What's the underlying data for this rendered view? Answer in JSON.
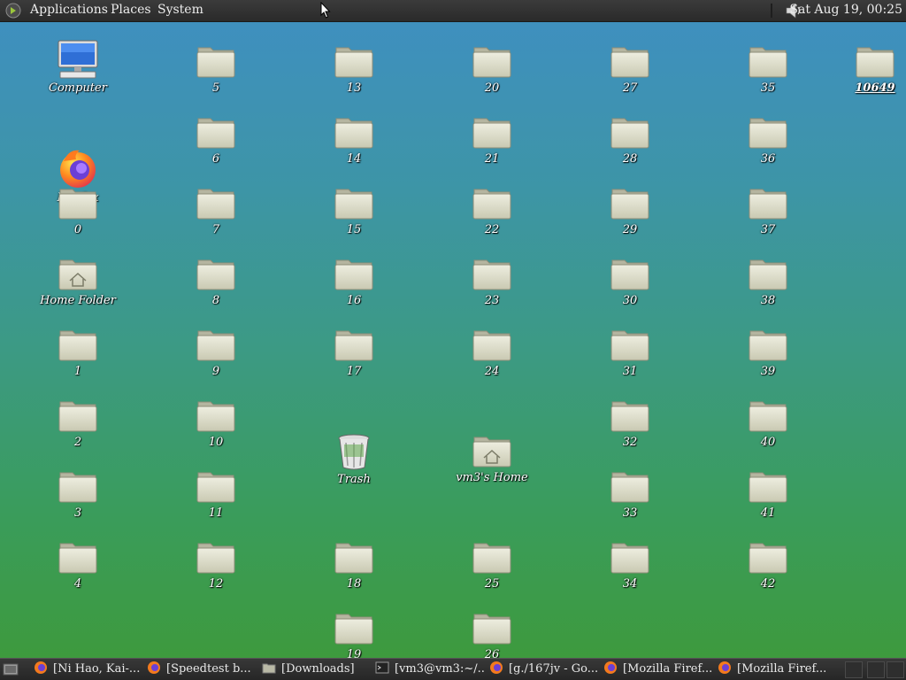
{
  "top_panel": {
    "menus": [
      "Applications",
      "Places",
      "System"
    ],
    "clock": "Sat Aug 19, 00:25"
  },
  "desktop": {
    "computer": "Computer",
    "firefox": "Firefox",
    "home_folder": "Home Folder",
    "trash": "Trash",
    "vm3_home": "vm3's Home",
    "corner_folder": "10649",
    "folders": [
      "0",
      "1",
      "2",
      "3",
      "4",
      "5",
      "6",
      "7",
      "8",
      "9",
      "10",
      "11",
      "12",
      "13",
      "14",
      "15",
      "16",
      "17",
      "18",
      "19",
      "20",
      "21",
      "22",
      "23",
      "24",
      "25",
      "26",
      "27",
      "28",
      "29",
      "30",
      "31",
      "32",
      "33",
      "34",
      "35",
      "36",
      "37",
      "38",
      "39",
      "40",
      "41",
      "42"
    ]
  },
  "taskbar": {
    "tasks": [
      {
        "label": "[Ni Hao, Kai-...",
        "icon": "firefox-icon"
      },
      {
        "label": "[Speedtest b...",
        "icon": "firefox-icon"
      },
      {
        "label": "[Downloads]",
        "icon": "folder-icon"
      },
      {
        "label": "[vm3@vm3:~/...",
        "icon": "terminal-icon"
      },
      {
        "label": "[g./167jv - Go...",
        "icon": "firefox-icon"
      },
      {
        "label": "[Mozilla Firef...",
        "icon": "firefox-icon"
      },
      {
        "label": "[Mozilla Firef...",
        "icon": "firefox-icon"
      }
    ]
  }
}
